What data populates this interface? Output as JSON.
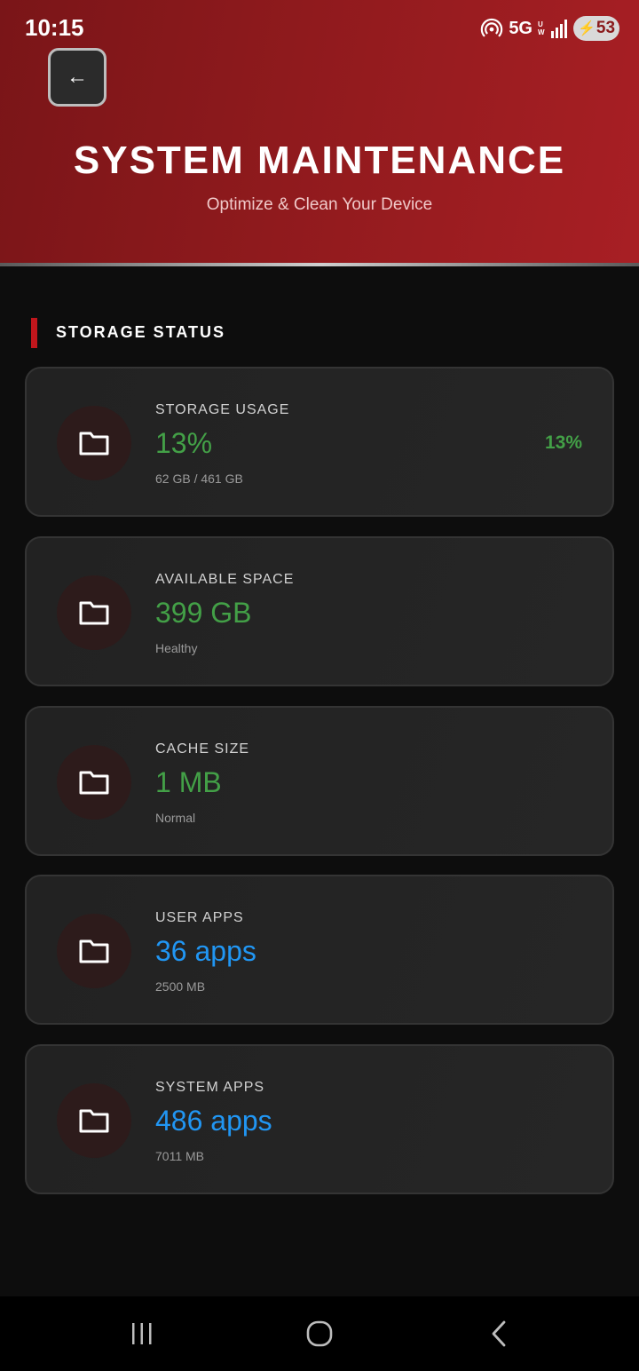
{
  "status_bar": {
    "time": "10:15",
    "network": "5G",
    "network_sub": "UW",
    "battery": "53"
  },
  "header": {
    "back_label": "←",
    "title": "SYSTEM MAINTENANCE",
    "subtitle": "Optimize & Clean Your Device"
  },
  "section": {
    "title": "STORAGE STATUS"
  },
  "cards": [
    {
      "label": "STORAGE USAGE",
      "value": "13%",
      "sub": "62 GB / 461 GB",
      "percent_text": "13%",
      "value_color": "#43a047",
      "icon": "folder-icon"
    },
    {
      "label": "AVAILABLE SPACE",
      "value": "399 GB",
      "sub": "Healthy",
      "value_color": "#43a047",
      "icon": "folder-icon"
    },
    {
      "label": "CACHE SIZE",
      "value": "1 MB",
      "sub": "Normal",
      "value_color": "#43a047",
      "icon": "folder-icon"
    },
    {
      "label": "USER APPS",
      "value": "36 apps",
      "sub": "2500 MB",
      "value_color": "#2196f3",
      "icon": "folder-icon"
    },
    {
      "label": "SYSTEM APPS",
      "value": "486 apps",
      "sub": "7011 MB",
      "value_color": "#2196f3",
      "icon": "folder-icon"
    }
  ],
  "nav": {
    "icons": [
      "recents-icon",
      "home-icon",
      "back-icon"
    ]
  },
  "colors": {
    "header_red": "#a81f24",
    "accent_red": "#c0161c",
    "green": "#43a047",
    "blue": "#2196f3"
  }
}
